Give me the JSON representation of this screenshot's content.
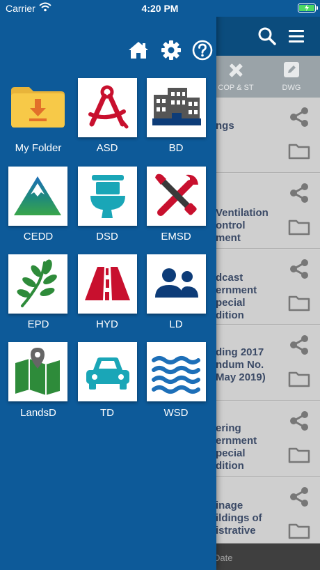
{
  "status_bar": {
    "carrier": "Carrier",
    "time": "4:20 PM",
    "battery_state": "charging"
  },
  "colors": {
    "drawer_bg": "#0d5a99",
    "header_bg": "#0b4c7d",
    "icon_red": "#c8102e",
    "icon_navy": "#0d3c78",
    "icon_green": "#2e8b3a",
    "icon_teal": "#1aa6b7",
    "folder_yellow": "#f7c948"
  },
  "drawer": {
    "top_icons": [
      "home-icon",
      "gear-icon",
      "help-icon"
    ],
    "tiles": [
      {
        "label": "My Folder",
        "icon": "download-folder-icon"
      },
      {
        "label": "ASD",
        "icon": "drafting-compass-icon"
      },
      {
        "label": "BD",
        "icon": "buildings-icon"
      },
      {
        "label": "CEDD",
        "icon": "mountain-icon"
      },
      {
        "label": "DSD",
        "icon": "toilet-icon"
      },
      {
        "label": "EMSD",
        "icon": "tools-icon"
      },
      {
        "label": "EPD",
        "icon": "leaf-icon"
      },
      {
        "label": "HYD",
        "icon": "road-icon"
      },
      {
        "label": "LD",
        "icon": "people-icon"
      },
      {
        "label": "LandsD",
        "icon": "map-pin-icon"
      },
      {
        "label": "TD",
        "icon": "car-icon"
      },
      {
        "label": "WSD",
        "icon": "water-waves-icon"
      }
    ]
  },
  "background_app": {
    "tabs": [
      {
        "label": "COP & ST",
        "icon": "ruler-pencil-icon"
      },
      {
        "label": "DWG",
        "icon": "edit-icon"
      }
    ],
    "rows": [
      {
        "text": "ngs"
      },
      {
        "text": "Ventilation\nontrol\nment"
      },
      {
        "text": "dcast\nernment\npecial\ndition"
      },
      {
        "text": "ding 2017\nndum No.\nMay 2019)"
      },
      {
        "text": "ering\nernment\npecial\ndition"
      },
      {
        "text": "inage\nildings of\nistrative"
      }
    ],
    "footer_text": "Date"
  }
}
